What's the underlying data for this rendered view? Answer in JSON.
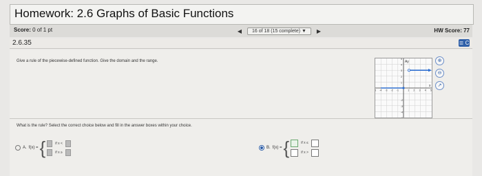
{
  "header": {
    "title": "Homework: 2.6 Graphs of Basic Functions"
  },
  "score": {
    "label": "Score:",
    "value": "0 of 1 pt"
  },
  "nav": {
    "prev": "◀",
    "position": "16 of 18 (15 complete)",
    "caret": "▼",
    "next": "▶"
  },
  "hw_score": "HW Score: 77",
  "question_number": "2.6.35",
  "menu_icon": "≣ C",
  "prompt": "Give a rule of the piecewise-defined function. Give the domain and the range.",
  "question": "What is the rule? Select the correct choice below and fill in the answer boxes within your choice.",
  "graph": {
    "x_label": "x",
    "y_label": "Ay",
    "y_ticks": [
      "5",
      "4",
      "3",
      "2",
      "1",
      "-2",
      "-3",
      "-4",
      "-5"
    ],
    "x_ticks": [
      "-5",
      "-4",
      "-3",
      "-2",
      "-1",
      "1",
      "2",
      "3",
      "4",
      "5"
    ]
  },
  "options": {
    "a": {
      "letter": "A.",
      "fx": "f(x) =",
      "cond1": "if x <",
      "cond2": "if x ≥"
    },
    "b": {
      "letter": "B.",
      "fx": "f(x) =",
      "cond1": "if x ≤",
      "cond2": "if x >"
    },
    "selected": "b"
  },
  "icons": [
    "zoom-in-icon",
    "zoom-out-icon",
    "external-link-icon"
  ]
}
